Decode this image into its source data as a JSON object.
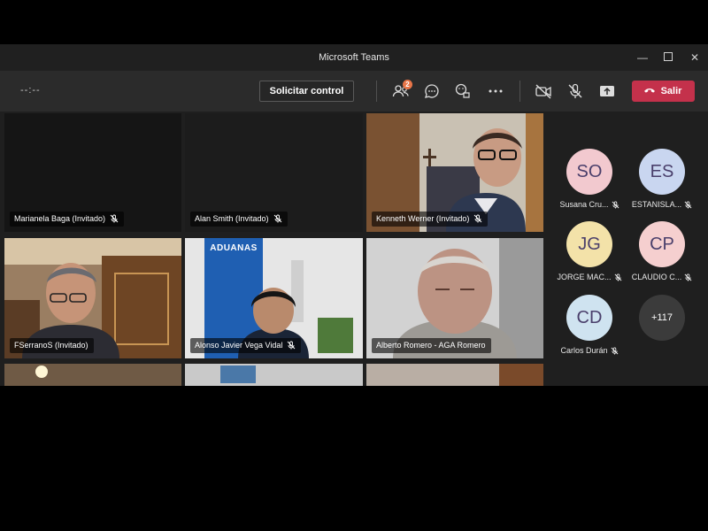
{
  "window": {
    "title": "Microsoft Teams"
  },
  "toolbar": {
    "timer": "--:--",
    "request_control_label": "Solicitar control",
    "participants_badge": "2",
    "leave_label": "Salir",
    "colors": {
      "leave": "#c4314b",
      "badge": "#e97548"
    }
  },
  "tiles": [
    {
      "name": "Marianela Baga (Invitado)"
    },
    {
      "name": "Alan Smith (Invitado)"
    },
    {
      "name": "Kenneth Werner (Invitado)"
    },
    {
      "name": "FSerranoS (Invitado)"
    },
    {
      "name": "Alonso Javier Vega Vidal"
    },
    {
      "name": "Alberto Romero - AGA Romero"
    }
  ],
  "banner_text": "ADUANAS",
  "roster": [
    {
      "initials": "SO",
      "name": "Susana Cru...",
      "color": "#f2c9cf"
    },
    {
      "initials": "ES",
      "name": "ESTANISLA...",
      "color": "#c9d6f0"
    },
    {
      "initials": "JG",
      "name": "JORGE MAC...",
      "color": "#f3e2a9"
    },
    {
      "initials": "CP",
      "name": "CLAUDIO C...",
      "color": "#f5cfcf"
    },
    {
      "initials": "CD",
      "name": "Carlos Durán",
      "color": "#cfe3f0"
    }
  ],
  "more_count": "+117"
}
